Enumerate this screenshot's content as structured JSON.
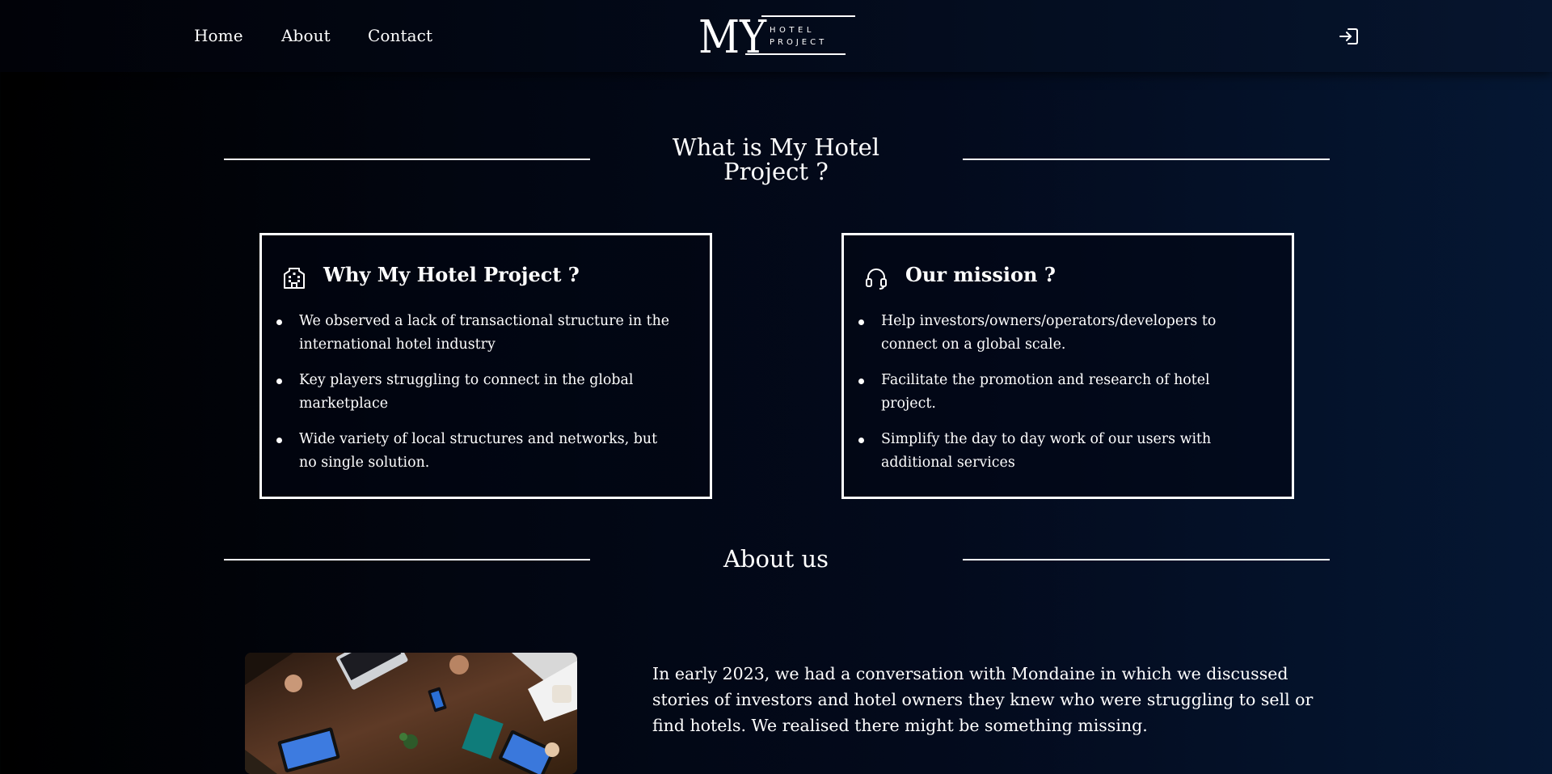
{
  "nav": {
    "home": "Home",
    "about": "About",
    "contact": "Contact"
  },
  "logo": {
    "monogram": "MY",
    "line1": "HOTEL",
    "line2": "PROJECT"
  },
  "header_actions": {
    "login_icon": "login-icon"
  },
  "section1": {
    "title_line1": "What is My Hotel",
    "title_line2": "Project ?"
  },
  "cards": [
    {
      "icon": "building-icon",
      "title": "Why My Hotel Project ?",
      "bullets": [
        "We observed a lack of transactional structure in the international hotel industry",
        "Key players struggling to connect in the global marketplace",
        "Wide variety of local structures and networks, but no single solution."
      ]
    },
    {
      "icon": "headset-icon",
      "title": "Our mission ?",
      "bullets": [
        "Help investors/owners/operators/developers to connect on a global scale.",
        "Facilitate the promotion and research of hotel project.",
        "Simplify the day to day work of our users with additional services"
      ]
    }
  ],
  "section2": {
    "title": "About us"
  },
  "about": {
    "image": "meeting-table-photo",
    "text": "In early 2023, we had a conversation with Mondaine in which we discussed stories of investors and hotel owners they knew who were struggling to sell or find hotels. We realised there might be something missing."
  },
  "colors": {
    "background_left": "#000000",
    "background_right": "#051733",
    "text": "#ffffff",
    "card_border": "#ffffff"
  }
}
